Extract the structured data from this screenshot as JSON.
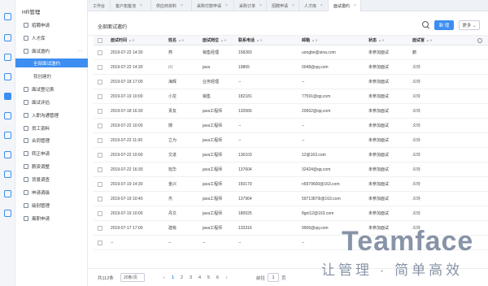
{
  "app": {
    "title": "HR管理"
  },
  "tabs": [
    {
      "label": "工作台",
      "active": false
    },
    {
      "label": "客户拓客池",
      "active": false
    },
    {
      "label": "供应商资料",
      "active": false
    },
    {
      "label": "采购付款申请",
      "active": false
    },
    {
      "label": "采购订单",
      "active": false
    },
    {
      "label": "招聘申请",
      "active": false
    },
    {
      "label": "人才库",
      "active": false
    },
    {
      "label": "面试邀约",
      "active": true
    }
  ],
  "sidebar": {
    "items": [
      {
        "label": "招聘申请"
      },
      {
        "label": "人才库"
      },
      {
        "label": "面试邀约"
      },
      {
        "label": "全部面试邀约"
      },
      {
        "label": "我创建的"
      },
      {
        "label": "面试登记表"
      },
      {
        "label": "面试评估"
      },
      {
        "label": "入职沟通管理"
      },
      {
        "label": "员工资料"
      },
      {
        "label": "合同管理"
      },
      {
        "label": "转正申请"
      },
      {
        "label": "薪资调整"
      },
      {
        "label": "背景调查"
      },
      {
        "label": "申请调级"
      },
      {
        "label": "级别管理"
      },
      {
        "label": "离职申请"
      }
    ],
    "more_label": "···"
  },
  "header": {
    "title": "全部面试邀约",
    "new_label": "新 增",
    "more_label": "更多 ⌄"
  },
  "table": {
    "columns": [
      "面试时间",
      "姓名",
      "面试岗位",
      "联系电话",
      "邮箱",
      "状态",
      "面试官"
    ],
    "rows": [
      {
        "time": "2019-07-22 14:30",
        "name": "燕",
        "position": "销售经理",
        "phone": "158283",
        "email": "uongbe@sina.com",
        "status": "未参加面试",
        "officer": "鹏"
      },
      {
        "time": "2019-07-22 14:30",
        "name": "川",
        "position": "java",
        "phone": "19865",
        "email": "0048@qq.com",
        "status": "未参加面试",
        "officer": "义玲"
      },
      {
        "time": "2019-07-18 17:00",
        "name": "海辉",
        "position": "业务经理",
        "phone": "--",
        "email": "--",
        "status": "未参加面试",
        "officer": "义玲"
      },
      {
        "time": "2019-07-19 10:00",
        "name": "小龙",
        "position": "销售",
        "phone": "182181",
        "email": "77591@qq.com",
        "status": "未参加面试",
        "officer": "义玲"
      },
      {
        "time": "2019-07-18 16:30",
        "name": "贵友",
        "position": "java工程师",
        "phone": "132666",
        "email": "20662@qq.com",
        "status": "未参加面试",
        "officer": "义玲"
      },
      {
        "time": "2019-07-22 10:00",
        "name": "嫦",
        "position": "java工程师",
        "phone": "--",
        "email": "--",
        "status": "未参加面试",
        "officer": "义玲"
      },
      {
        "time": "2019-07-22 11:00",
        "name": "立为",
        "position": "java工程师",
        "phone": "--",
        "email": "--",
        "status": "未参加面试",
        "officer": "义玲"
      },
      {
        "time": "2019-07-22 10:00",
        "name": "文进",
        "position": "java工程师",
        "phone": "136103",
        "email": "12@163.com",
        "status": "未参加面试",
        "officer": "义玲"
      },
      {
        "time": "2019-07-22 16:30",
        "name": "旭华",
        "position": "java工程师",
        "phone": "137604",
        "email": "32424@qq.com",
        "status": "未参加面试",
        "officer": "义玲"
      },
      {
        "time": "2019-07-19 14:30",
        "name": "金兴",
        "position": "java工程师",
        "phone": "150179",
        "email": "n5979600@163.com",
        "status": "未参加面试",
        "officer": "义玲"
      },
      {
        "time": "2019-07-19 10:40",
        "name": "杰",
        "position": "java工程师",
        "phone": "137964",
        "email": "59713870l@163.com",
        "status": "未参加面试",
        "officer": "义玲"
      },
      {
        "time": "2019-07-19 10:00",
        "name": "丹文",
        "position": "java工程师",
        "phone": "180025",
        "email": "8gnl12@163.com",
        "status": "未参加面试",
        "officer": "义玲"
      },
      {
        "time": "2019-07-17 17:00",
        "name": "建栋",
        "position": "java工程师",
        "phone": "133316",
        "email": "9906@qq.com",
        "status": "未参加面试",
        "officer": "义玲"
      },
      {
        "time": "--",
        "name": "--",
        "position": "--",
        "phone": "--",
        "email": "--",
        "status": "",
        "officer": ""
      }
    ]
  },
  "footer": {
    "total": "共112条",
    "page_size": "20条/页",
    "pages": [
      "‹",
      "1",
      "2",
      "3",
      "4",
      "5",
      "6",
      "›"
    ],
    "current_page": "1",
    "goto_label": "前往",
    "goto_value": "1",
    "page_word": "页"
  },
  "watermark": {
    "brand": "Teamface",
    "slogan": "让管理 · 简单高效"
  },
  "colors": {
    "accent": "#3d8ef0"
  }
}
